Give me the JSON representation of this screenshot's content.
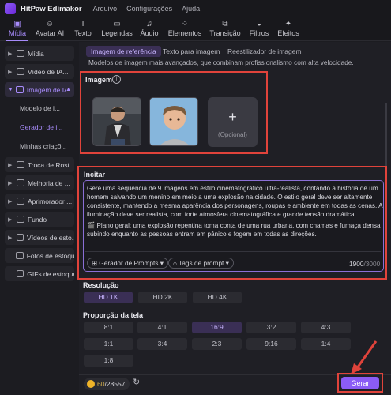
{
  "app": {
    "name": "HitPaw Edimakor"
  },
  "menu": [
    "Arquivo",
    "Configurações",
    "Ajuda"
  ],
  "toolbar": [
    {
      "label": "Mídia",
      "icon": "media-icon",
      "active": true
    },
    {
      "label": "Avatar AI",
      "icon": "avatar-icon"
    },
    {
      "label": "Texto",
      "icon": "text-icon"
    },
    {
      "label": "Legendas",
      "icon": "subtitles-icon"
    },
    {
      "label": "Áudio",
      "icon": "audio-icon"
    },
    {
      "label": "Elementos",
      "icon": "elements-icon"
    },
    {
      "label": "Transição",
      "icon": "transition-icon"
    },
    {
      "label": "Filtros",
      "icon": "filters-icon"
    },
    {
      "label": "Efeitos",
      "icon": "effects-icon"
    }
  ],
  "sidebar": {
    "items": [
      {
        "label": "Mídia"
      },
      {
        "label": "Vídeo de IA..."
      },
      {
        "label": "Imagem de IA",
        "open": true
      },
      {
        "label": "Troca de Rost..."
      },
      {
        "label": "Melhoria de ..."
      },
      {
        "label": "Aprimorador ..."
      },
      {
        "label": "Fundo"
      },
      {
        "label": "Vídeos de esto..."
      },
      {
        "label": "Fotos de estoque"
      },
      {
        "label": "GIFs de estoque"
      }
    ],
    "subitems": [
      {
        "label": "Modelo de i..."
      },
      {
        "label": "Gerador de i...",
        "active": true
      },
      {
        "label": "Minhas criaçõ..."
      }
    ]
  },
  "tabs": [
    {
      "label": "Imagem de referência",
      "active": true
    },
    {
      "label": "Texto para imagem"
    },
    {
      "label": "Reestilizador de imagem"
    }
  ],
  "description": "Modelos de imagem mais avançados, que combinam profissionalismo com alta velocidade.",
  "image_section": {
    "title": "Imagem",
    "add_label": "+",
    "optional_label": "(Opcional)"
  },
  "prompt": {
    "title": "Incitar",
    "paragraph1": "Gere uma sequência de 9 imagens em estilo cinematográfico ultra-realista, contando a história de um homem salvando um menino em meio a uma explosão na cidade. O estilo geral deve ser altamente consistente, mantendo a mesma aparência dos personagens, roupas e ambiente em todas as cenas. A iluminação deve ser realista, com forte atmosfera cinematográfica e grande tensão dramática.",
    "paragraph2": "🎬 Plano geral: uma explosão repentina toma conta de uma rua urbana, com chamas e fumaça densa subindo enquanto as pessoas entram em pânico e fogem em todas as direções.",
    "chip_generator": "Gerador de Prompts",
    "chip_tags": "Tags de prompt",
    "count": "1900",
    "max": "/3000"
  },
  "resolution": {
    "title": "Resolução",
    "options": [
      {
        "label": "HD 1K",
        "active": true
      },
      {
        "label": "HD 2K"
      },
      {
        "label": "HD 4K"
      }
    ]
  },
  "aspect": {
    "title": "Proporção da tela",
    "options": [
      {
        "label": "8:1"
      },
      {
        "label": "4:1"
      },
      {
        "label": "16:9",
        "active": true
      },
      {
        "label": "3:2"
      },
      {
        "label": "4:3"
      },
      {
        "label": "1:1"
      },
      {
        "label": "3:4"
      },
      {
        "label": "2:3"
      },
      {
        "label": "9:16"
      },
      {
        "label": "1:4"
      },
      {
        "label": "1:8"
      }
    ]
  },
  "footer": {
    "credits_used": "60",
    "credits_total": "/28557",
    "generate_label": "Gerar"
  },
  "colors": {
    "accent": "#8b5cf6",
    "highlight_red": "#e0433b"
  }
}
